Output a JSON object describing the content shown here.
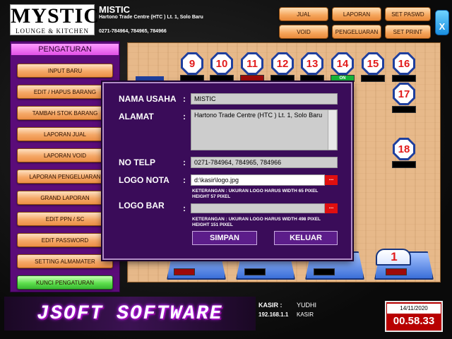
{
  "header": {
    "logo_main": "MYSTIC",
    "logo_sub": "LOUNGE & KITCHEN",
    "business_name": "MISTIC",
    "address": "Hartono Trade Centre (HTC ) Lt. 1, Solo Baru",
    "phone": "0271-784964, 784965, 784966",
    "buttons": {
      "jual": "JUAL",
      "laporan": "LAPORAN",
      "set_paswd": "SET PASWD",
      "void": "VOID",
      "pengeluaran": "PENGELUARAN",
      "set_print": "SET PRINT"
    },
    "close": "X"
  },
  "sidebar": {
    "title": "PENGATURAN",
    "items": [
      "INPUT BARU",
      "EDIT / HAPUS  BARANG",
      "TAMBAH STOK BARANG",
      "LAPORAN JUAL",
      "LAPORAN VOID",
      "LAPORAN PENGELUARAN",
      "GRAND LAPORAN",
      "EDIT PPN / SC",
      "EDIT PASSWORD",
      "SETTING ALMAMATER",
      "KUNCI PENGATURAN"
    ]
  },
  "tables": {
    "t9": "9",
    "t10": "10",
    "t11": "11",
    "t12": "12",
    "t13": "13",
    "t14": "14",
    "t15": "15",
    "t16": "16",
    "t17": "17",
    "t18": "18",
    "t14_status": "ON",
    "t1": "1"
  },
  "dialog": {
    "nama_usaha_label": "NAMA USAHA",
    "nama_usaha_value": "MISTIC",
    "alamat_label": "ALAMAT",
    "alamat_value": "Hartono Trade Centre (HTC ) Lt. 1, Solo Baru",
    "no_telp_label": "NO TELP",
    "no_telp_value": "0271-784964, 784965, 784966",
    "logo_nota_label": "LOGO NOTA",
    "logo_nota_value": "d:\\kasir\\logo.jpg",
    "logo_nota_note": "KETERANGAN : UKURAN LOGO HARUS WIDTH 65 PIXEL HEIGHT 57 PIXEL",
    "logo_bar_label": "LOGO BAR",
    "logo_bar_value": "",
    "logo_bar_note": "KETERANGAN : UKURAN LOGO HARUS WIDTH 498 PIXEL HEIGHT 151 PIXEL",
    "colon": ":",
    "browse": "...",
    "simpan": "SIMPAN",
    "keluar": "KELUAR"
  },
  "footer": {
    "brand": "JSOFT SOFTWARE",
    "kasir_label": "KASIR :",
    "kasir_name": "YUDHI",
    "ip": "192.168.1.1",
    "role": "KASIR",
    "date": "14/11/2020",
    "time": "00.58.33"
  }
}
